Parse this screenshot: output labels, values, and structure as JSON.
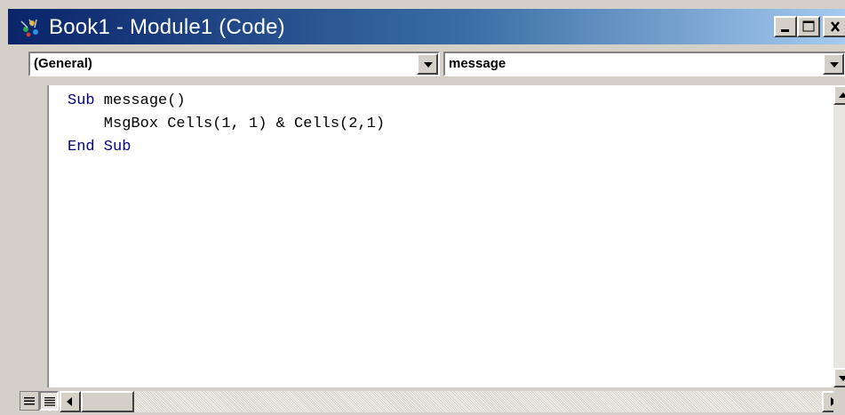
{
  "window": {
    "title": "Book1 - Module1 (Code)",
    "icon": "vba-module-icon",
    "controls": {
      "minimize": "minimize-icon",
      "maximize": "maximize-icon",
      "close": "close-icon"
    }
  },
  "combos": {
    "object": {
      "value": "(General)"
    },
    "procedure": {
      "value": "message"
    }
  },
  "code": {
    "lines": [
      {
        "keyword": "Sub",
        "rest": " message()"
      },
      {
        "keyword": "",
        "rest": "    MsgBox Cells(1, 1) & Cells(2,1)"
      },
      {
        "keyword": "End Sub",
        "rest": ""
      }
    ]
  },
  "colors": {
    "keyword": "#00007f",
    "titlebar_start": "#0a246a",
    "titlebar_end": "#a6caf0",
    "chrome": "#d4d0c8"
  },
  "footer": {
    "procedure_view": "procedure-view-icon",
    "full_module_view": "full-module-view-icon"
  }
}
